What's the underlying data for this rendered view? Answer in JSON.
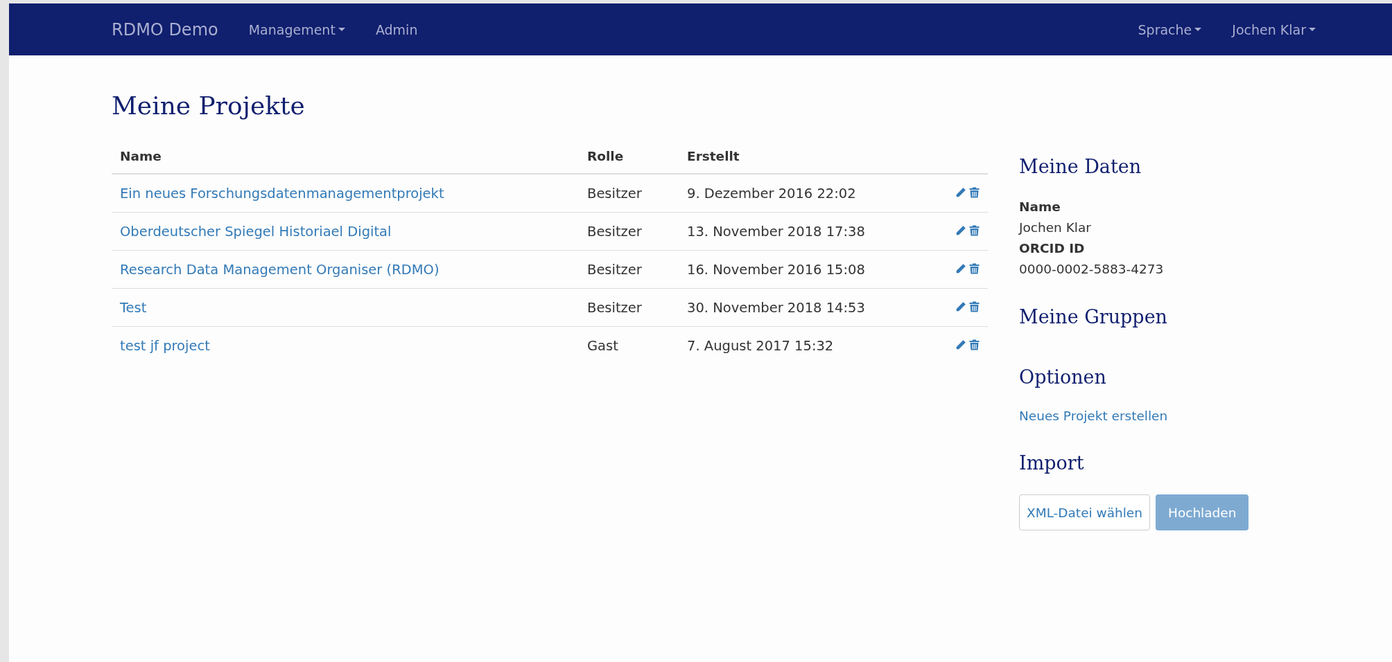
{
  "navbar": {
    "brand": "RDMO Demo",
    "left_items": [
      {
        "label": "Management",
        "dropdown": true
      },
      {
        "label": "Admin",
        "dropdown": false
      }
    ],
    "right_items": [
      {
        "label": "Sprache",
        "dropdown": true
      },
      {
        "label": "Jochen Klar",
        "dropdown": true
      }
    ]
  },
  "page_title": "Meine Projekte",
  "table": {
    "columns": [
      "Name",
      "Rolle",
      "Erstellt"
    ],
    "rows": [
      {
        "name": "Ein neues Forschungsdatenmanagementprojekt",
        "role": "Besitzer",
        "created": "9. Dezember 2016 22:02"
      },
      {
        "name": "Oberdeutscher Spiegel Historiael Digital",
        "role": "Besitzer",
        "created": "13. November 2018 17:38"
      },
      {
        "name": "Research Data Management Organiser (RDMO)",
        "role": "Besitzer",
        "created": "16. November 2016 15:08"
      },
      {
        "name": "Test",
        "role": "Besitzer",
        "created": "30. November 2018 14:53"
      },
      {
        "name": "test jf project",
        "role": "Gast",
        "created": "7. August 2017 15:32"
      }
    ]
  },
  "sidebar": {
    "my_data": {
      "title": "Meine Daten",
      "fields": [
        {
          "label": "Name",
          "value": "Jochen Klar"
        },
        {
          "label": "ORCID ID",
          "value": "0000-0002-5883-4273"
        }
      ]
    },
    "my_groups": {
      "title": "Meine Gruppen"
    },
    "options": {
      "title": "Optionen",
      "links": [
        "Neues Projekt erstellen"
      ]
    },
    "import": {
      "title": "Import",
      "file_button": "XML-Datei wählen",
      "upload_button": {
        "label": "Hochladen",
        "disabled": true
      }
    }
  }
}
